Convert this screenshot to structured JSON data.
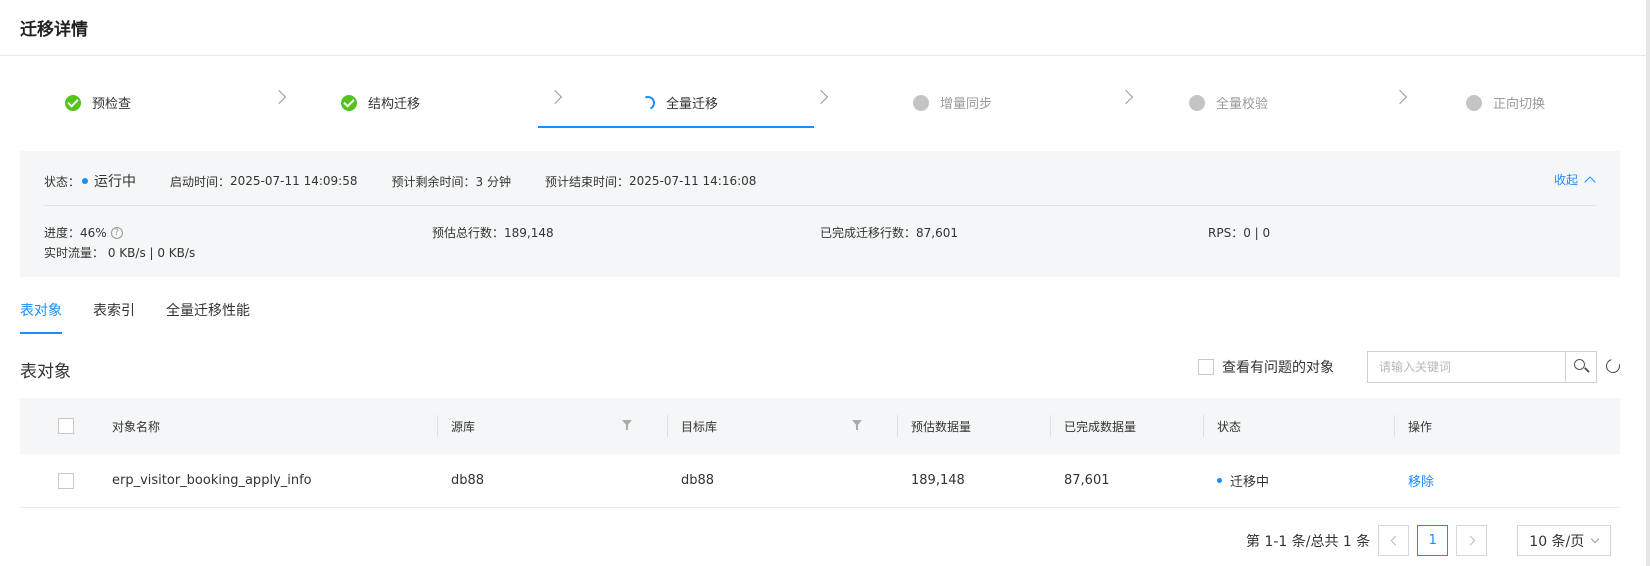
{
  "header": {
    "title": "迁移详情"
  },
  "steps": [
    {
      "label": "预检查",
      "state": "done"
    },
    {
      "label": "结构迁移",
      "state": "done"
    },
    {
      "label": "全量迁移",
      "state": "running"
    },
    {
      "label": "增量同步",
      "state": "pending"
    },
    {
      "label": "全量校验",
      "state": "pending"
    },
    {
      "label": "正向切换",
      "state": "pending"
    }
  ],
  "status_panel": {
    "status_label": "状态：",
    "status_value": "运行中",
    "start_time_label": "启动时间：",
    "start_time_value": "2025-07-11 14:09:58",
    "remaining_label": "预计剩余时间：",
    "remaining_value": "3 分钟",
    "end_time_label": "预计结束时间：",
    "end_time_value": "2025-07-11 14:16:08",
    "collapse_label": "收起",
    "progress_label": "进度：",
    "progress_value": "46%",
    "estimated_rows_label": "预估总行数：",
    "estimated_rows_value": "189,148",
    "migrated_rows_label": "已完成迁移行数：",
    "migrated_rows_value": "87,601",
    "rps_label": "RPS：",
    "rps_value": "0 | 0",
    "flow_label": "实时流量：",
    "flow_value": "0 KB/s | 0 KB/s",
    "help_icon": "question-circle-icon",
    "collapse_icon": "chevron-up-icon"
  },
  "tabs": [
    {
      "label": "表对象",
      "active": true
    },
    {
      "label": "表索引",
      "active": false
    },
    {
      "label": "全量迁移性能",
      "active": false
    }
  ],
  "section": {
    "title": "表对象",
    "problem_filter_label": "查看有问题的对象",
    "search_placeholder": "请输入关键词"
  },
  "table": {
    "columns": [
      "对象名称",
      "源库",
      "目标库",
      "预估数据量",
      "已完成数据量",
      "状态",
      "操作"
    ],
    "rows": [
      {
        "name": "erp_visitor_booking_apply_info",
        "source": "db88",
        "target": "db88",
        "estimated": "189,148",
        "completed": "87,601",
        "status": "迁移中",
        "action": "移除"
      }
    ]
  },
  "pagination": {
    "summary": "第 1-1 条/总共 1 条",
    "current_page": "1",
    "page_size": "10 条/页"
  },
  "colors": {
    "accent": "#1a8cff",
    "success": "#52c41a",
    "pending": "#c4c4c4"
  }
}
